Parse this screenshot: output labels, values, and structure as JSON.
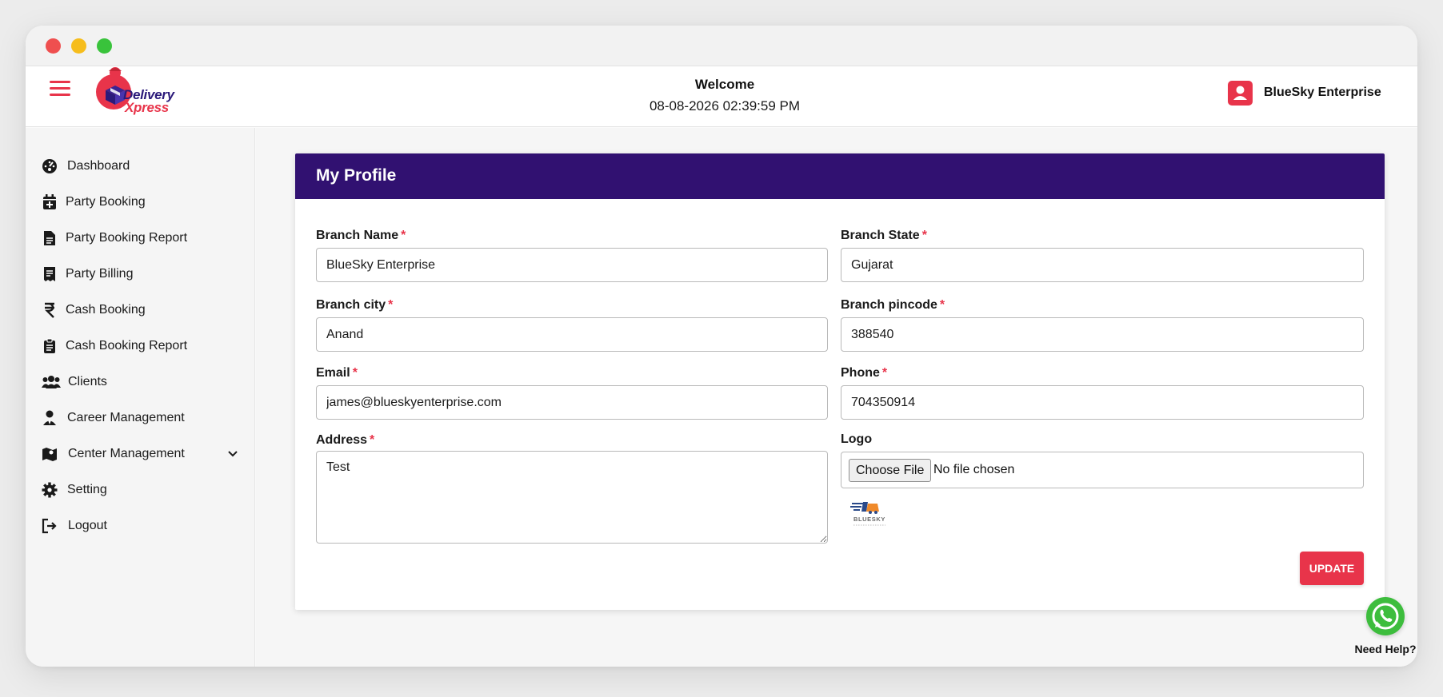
{
  "brand": {
    "line1": "Delivery",
    "line2": "Xpress",
    "accent_color": "#e8344a",
    "primary_color": "#311171"
  },
  "header": {
    "welcome": "Welcome",
    "datetime": "08-08-2026 02:39:59 PM",
    "user_name": "BlueSky Enterprise",
    "user_icon": "user-icon",
    "menu_icon": "hamburger-icon"
  },
  "sidebar": {
    "items": [
      {
        "label": "Dashboard",
        "icon": "dashboard-icon"
      },
      {
        "label": "Party Booking",
        "icon": "calendar-plus-icon"
      },
      {
        "label": "Party Booking Report",
        "icon": "file-icon"
      },
      {
        "label": "Party Billing",
        "icon": "receipt-icon"
      },
      {
        "label": "Cash Booking",
        "icon": "rupee-icon"
      },
      {
        "label": "Cash Booking Report",
        "icon": "clipboard-icon"
      },
      {
        "label": "Clients",
        "icon": "users-icon"
      },
      {
        "label": "Career Management",
        "icon": "user-tie-icon"
      },
      {
        "label": "Center Management",
        "icon": "map-icon"
      },
      {
        "label": "Setting",
        "icon": "gear-icon"
      },
      {
        "label": "Logout",
        "icon": "logout-icon"
      }
    ]
  },
  "profile": {
    "title": "My Profile",
    "fields": {
      "branch_name": {
        "label": "Branch Name",
        "value": "BlueSky Enterprise"
      },
      "branch_state": {
        "label": "Branch State",
        "value": "Gujarat"
      },
      "branch_city": {
        "label": "Branch city",
        "value": "Anand"
      },
      "branch_pincode": {
        "label": "Branch pincode",
        "value": "388540"
      },
      "email": {
        "label": "Email",
        "value": "james@blueskyenterprise.com"
      },
      "phone": {
        "label": "Phone",
        "value": "704350914"
      },
      "address": {
        "label": "Address",
        "value": "Test"
      },
      "logo": {
        "label": "Logo",
        "button": "Choose File",
        "status": "No file chosen"
      }
    },
    "required_mark": "*",
    "logo_preview_text": "BLUESKY",
    "update_label": "UPDATE"
  },
  "help": {
    "label": "Need Help?",
    "icon": "whatsapp-icon"
  }
}
